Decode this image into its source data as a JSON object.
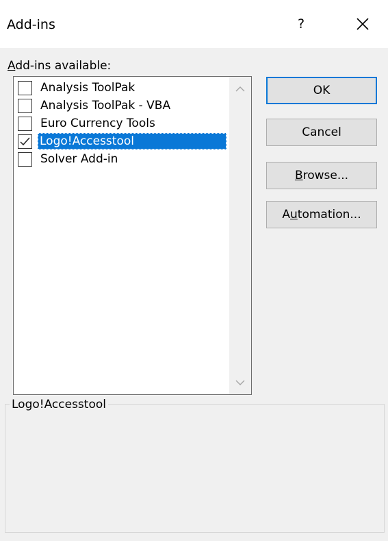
{
  "dialog": {
    "title": "Add-ins",
    "help_label": "?"
  },
  "list": {
    "label_prefix": "A",
    "label_rest": "dd-ins available:",
    "items": [
      {
        "label": "Analysis ToolPak",
        "checked": false,
        "selected": false
      },
      {
        "label": "Analysis ToolPak - VBA",
        "checked": false,
        "selected": false
      },
      {
        "label": "Euro Currency Tools",
        "checked": false,
        "selected": false
      },
      {
        "label": "Logo!Accesstool",
        "checked": true,
        "selected": true
      },
      {
        "label": "Solver Add-in",
        "checked": false,
        "selected": false
      }
    ]
  },
  "buttons": {
    "ok": "OK",
    "cancel": "Cancel",
    "browse_prefix": "B",
    "browse_rest": "rowse...",
    "automation_a": "A",
    "automation_u": "u",
    "automation_rest": "tomation..."
  },
  "description": {
    "title": "Logo!Accesstool"
  },
  "colors": {
    "selection": "#0a78d7",
    "default_button_border": "#0a78d7",
    "dialog_bg": "#f0f0f0"
  },
  "icons": {
    "close": "close-icon",
    "scroll_up": "chevron-up-icon",
    "scroll_down": "chevron-down-icon",
    "check": "check-icon"
  }
}
